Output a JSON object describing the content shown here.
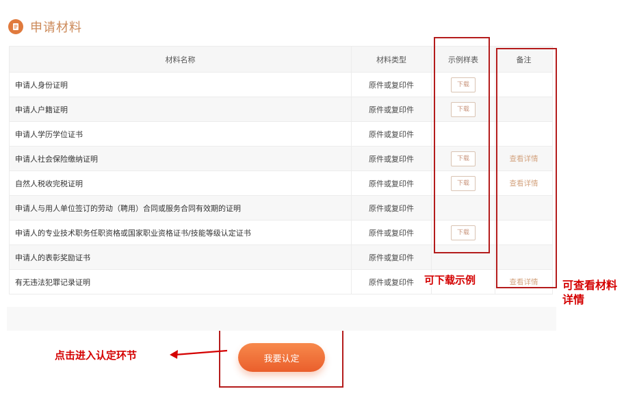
{
  "section": {
    "title": "申请材料",
    "icon": "document-icon"
  },
  "table": {
    "headers": {
      "name": "材料名称",
      "type": "材料类型",
      "sample": "示例样表",
      "note": "备注"
    },
    "rows": [
      {
        "name": "申请人身份证明",
        "type": "原件或复印件",
        "sample": "下载",
        "note": ""
      },
      {
        "name": "申请人户籍证明",
        "type": "原件或复印件",
        "sample": "下载",
        "note": ""
      },
      {
        "name": "申请人学历学位证书",
        "type": "原件或复印件",
        "sample": "",
        "note": ""
      },
      {
        "name": "申请人社会保险缴纳证明",
        "type": "原件或复印件",
        "sample": "下载",
        "note": "查看详情"
      },
      {
        "name": "自然人税收完税证明",
        "type": "原件或复印件",
        "sample": "下载",
        "note": "查看详情"
      },
      {
        "name": "申请人与用人单位签订的劳动（聘用）合同或服务合同有效期的证明",
        "type": "原件或复印件",
        "sample": "",
        "note": ""
      },
      {
        "name": "申请人的专业技术职务任职资格或国家职业资格证书/技能等级认定证书",
        "type": "原件或复印件",
        "sample": "下载",
        "note": ""
      },
      {
        "name": "申请人的表彰奖励证书",
        "type": "原件或复印件",
        "sample": "",
        "note": ""
      },
      {
        "name": "有无违法犯罪记录证明",
        "type": "原件或复印件",
        "sample": "",
        "note": "查看详情"
      }
    ]
  },
  "annotations": {
    "download_sample": "可下载示例",
    "view_details": "可查看材料详情",
    "click_enter": "点击进入认定环节"
  },
  "cta": {
    "label": "我要认定"
  },
  "colors": {
    "accent": "#ea5f2c",
    "highlight": "#b41b1b",
    "annotation": "#d40000"
  }
}
